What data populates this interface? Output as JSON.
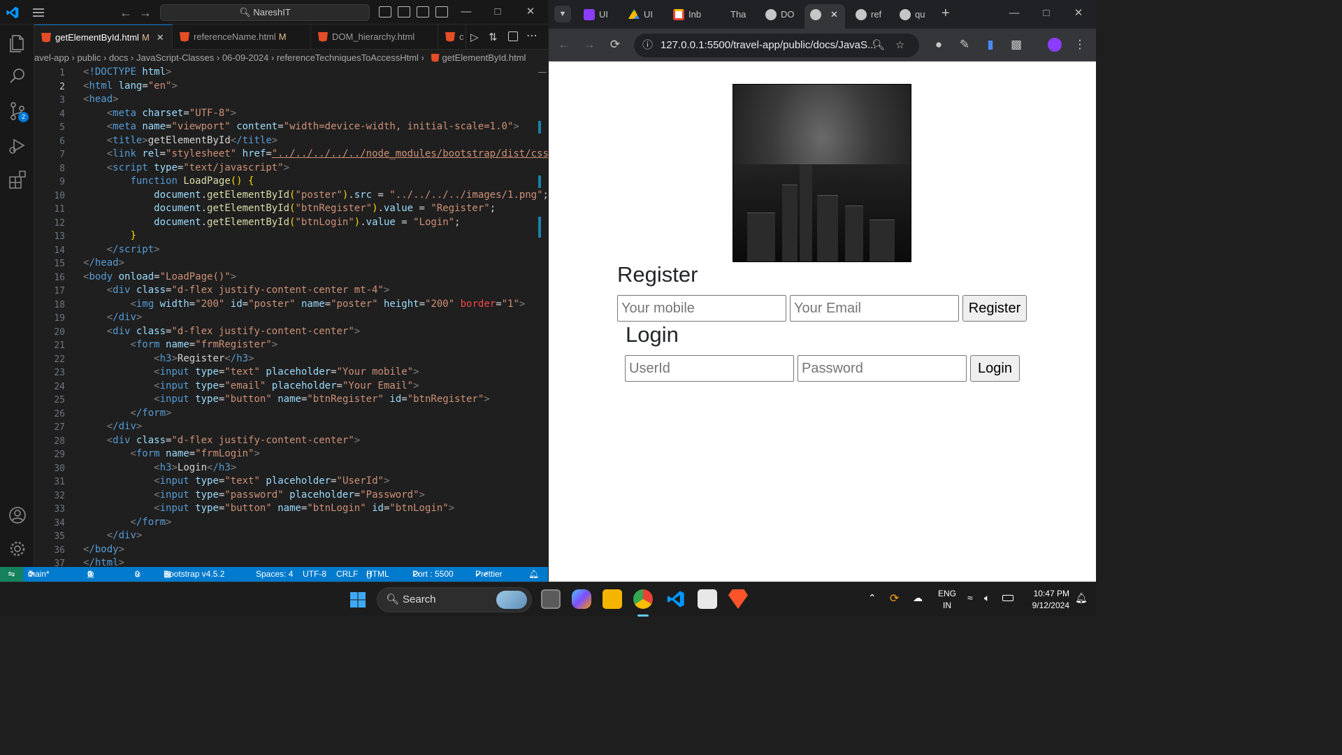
{
  "vscode": {
    "search_text": "NareshIT",
    "tabs": [
      {
        "label": "getElementById.html",
        "modified": "M"
      },
      {
        "label": "referenceName.html",
        "modified": "M"
      },
      {
        "label": "DOM_hierarchy.html",
        "modified": ""
      },
      {
        "label": "c",
        "modified": ""
      }
    ],
    "breadcrumb": [
      "avel-app",
      "public",
      "docs",
      "JavaScript-Classes",
      "06-09-2024",
      "referenceTechniquesToAccessHtml",
      "getElementById.html"
    ],
    "scm_badge": "2",
    "line_numbers": [
      "1",
      "2",
      "3",
      "4",
      "5",
      "6",
      "7",
      "8",
      "9",
      "10",
      "11",
      "12",
      "13",
      "14",
      "15",
      "16",
      "17",
      "18",
      "19",
      "20",
      "21",
      "22",
      "23",
      "24",
      "25",
      "26",
      "27",
      "28",
      "29",
      "30",
      "31",
      "32",
      "33",
      "34",
      "35",
      "36",
      "37"
    ],
    "code": {
      "l1_tag": "!DOCTYPE",
      "l1_attr": "html",
      "l2_tag": "html",
      "l2_attr": "lang",
      "l2_val": "\"en\"",
      "l3_tag": "head",
      "l4_tag": "meta",
      "l4_attr": "charset",
      "l4_val": "\"UTF-8\"",
      "l5_tag": "meta",
      "l5_a1": "name",
      "l5_v1": "\"viewport\"",
      "l5_a2": "content",
      "l5_v2": "\"width=device-width, initial-scale=1.0\"",
      "l6_tag": "title",
      "l6_text": "getElementById",
      "l6_close": "/title",
      "l7_tag": "link",
      "l7_a1": "rel",
      "l7_v1": "\"stylesheet\"",
      "l7_a2": "href",
      "l7_v2": "\"../../../../../node_modules/bootstrap/dist/css/boots",
      "l8_tag": "script",
      "l8_attr": "type",
      "l8_val": "\"text/javascript\"",
      "l9_kw": "function",
      "l9_fn": "LoadPage",
      "l9_rest": "() {",
      "l10_obj": "document",
      "l10_fn": "getElementById",
      "l10_arg": "\"poster\"",
      "l10_prop": "src",
      "l10_val": "\"../../../../images/1.png\"",
      "l11_obj": "document",
      "l11_fn": "getElementById",
      "l11_arg": "\"btnRegister\"",
      "l11_prop": "value",
      "l11_val": "\"Register\"",
      "l12_obj": "document",
      "l12_fn": "getElementById",
      "l12_arg": "\"btnLogin\"",
      "l12_prop": "value",
      "l12_val": "\"Login\"",
      "l13": "}",
      "l14_tag": "/script",
      "l15_tag": "/head",
      "l16_tag": "body",
      "l16_attr": "onload",
      "l16_val": "\"LoadPage()\"",
      "l17_tag": "div",
      "l17_attr": "class",
      "l17_val": "\"d-flex justify-content-center mt-4\"",
      "l18_tag": "img",
      "l18_a1": "width",
      "l18_v1": "\"200\"",
      "l18_a2": "id",
      "l18_v2": "\"poster\"",
      "l18_a3": "name",
      "l18_v3": "\"poster\"",
      "l18_a4": "height",
      "l18_v4": "\"200\"",
      "l18_a5": "border",
      "l18_v5": "\"1\"",
      "l19_tag": "/div",
      "l20_tag": "div",
      "l20_attr": "class",
      "l20_val": "\"d-flex justify-content-center\"",
      "l21_tag": "form",
      "l21_attr": "name",
      "l21_val": "\"frmRegister\"",
      "l22_tag": "h3",
      "l22_text": "Register",
      "l22_close": "/h3",
      "l23_tag": "input",
      "l23_a1": "type",
      "l23_v1": "\"text\"",
      "l23_a2": "placeholder",
      "l23_v2": "\"Your mobile\"",
      "l24_tag": "input",
      "l24_a1": "type",
      "l24_v1": "\"email\"",
      "l24_a2": "placeholder",
      "l24_v2": "\"Your Email\"",
      "l25_tag": "input",
      "l25_a1": "type",
      "l25_v1": "\"button\"",
      "l25_a2": "name",
      "l25_v2": "\"btnRegister\"",
      "l25_a3": "id",
      "l25_v3": "\"btnRegister\"",
      "l26_tag": "/form",
      "l27_tag": "/div",
      "l28_tag": "div",
      "l28_attr": "class",
      "l28_val": "\"d-flex justify-content-center\"",
      "l29_tag": "form",
      "l29_attr": "name",
      "l29_val": "\"frmLogin\"",
      "l30_tag": "h3",
      "l30_text": "Login",
      "l30_close": "/h3",
      "l31_tag": "input",
      "l31_a1": "type",
      "l31_v1": "\"text\"",
      "l31_a2": "placeholder",
      "l31_v2": "\"UserId\"",
      "l32_tag": "input",
      "l32_a1": "type",
      "l32_v1": "\"password\"",
      "l32_a2": "placeholder",
      "l32_v2": "\"Password\"",
      "l33_tag": "input",
      "l33_a1": "type",
      "l33_v1": "\"button\"",
      "l33_a2": "name",
      "l33_v2": "\"btnLogin\"",
      "l33_a3": "id",
      "l33_v3": "\"btnLogin\"",
      "l34_tag": "/form",
      "l35_tag": "/div",
      "l36_tag": "/body",
      "l37_tag": "/html"
    },
    "status": {
      "branch": "main*",
      "errors": "0",
      "warnings": "0",
      "ports": "0",
      "bootstrap": "Bootstrap v4.5.2",
      "spaces": "Spaces: 4",
      "encoding": "UTF-8",
      "eol": "CRLF",
      "language": "HTML",
      "port": "Port : 5500",
      "prettier": "Prettier"
    }
  },
  "chrome": {
    "tabs": [
      "UI",
      "UI",
      "Inb",
      "Tha",
      "DO",
      "",
      "ref",
      "qu"
    ],
    "url": "127.0.0.1:5500/travel-app/public/docs/JavaS...",
    "page": {
      "register_heading": "Register",
      "mobile_placeholder": "Your mobile",
      "email_placeholder": "Your Email",
      "register_button": "Register",
      "login_heading": "Login",
      "userid_placeholder": "UserId",
      "password_placeholder": "Password",
      "login_button": "Login"
    }
  },
  "taskbar": {
    "search_label": "Search",
    "lang_line1": "ENG",
    "lang_line2": "IN",
    "time": "10:47 PM",
    "date": "9/12/2024"
  },
  "colors": {
    "vscode_accent": "#007acc",
    "chrome_profile": "#8b3dff"
  }
}
